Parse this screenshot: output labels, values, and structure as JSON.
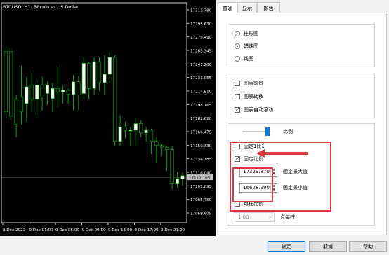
{
  "chart": {
    "title": "BTCUSD, H1: Bitcoin vs US Dollar",
    "price_labels": [
      "17311.780",
      "17295.630",
      "17279.490",
      "17263.345",
      "17247.200",
      "17231.055",
      "17214.910",
      "17198.765",
      "17182.620",
      "17166.475",
      "17150.330",
      "17134.185",
      "17118.040",
      "17101.895",
      "17085.750",
      "17069.605"
    ],
    "current_price": "17112.105",
    "time_labels": [
      "8 Dec 2022",
      "9 Dec 01:00",
      "9 Dec 05:00",
      "9 Dec 09:00",
      "9 Dec 13:00",
      "9 Dec 17:00",
      "9 Dec 21:00"
    ],
    "bull_color": "#ffffff",
    "bear_color": "#000000",
    "wick_color": "#00c000",
    "bg_color": "#000000"
  },
  "tabs": [
    {
      "label": "普通"
    },
    {
      "label": "显示"
    },
    {
      "label": "颜色"
    }
  ],
  "chart_type": {
    "options": [
      {
        "label": "柱形图",
        "selected": false
      },
      {
        "label": "蜡烛图",
        "selected": true
      },
      {
        "label": "线图",
        "selected": false
      }
    ]
  },
  "chart_options": {
    "items": [
      {
        "label": "图表前景",
        "checked": false
      },
      {
        "label": "图表转移",
        "checked": false
      },
      {
        "label": "图表自动滚动",
        "checked": true
      }
    ]
  },
  "scale": {
    "slider_label": "比例",
    "fix_1to1": {
      "label": "固定1比1",
      "checked": false
    },
    "fixed_scale": {
      "label": "固定比例",
      "checked": true
    },
    "max_value": "17329.870",
    "max_label": "固定最大值",
    "min_value": "16628.990",
    "min_label": "固定最小值",
    "per_bar": {
      "label": "每柱比例",
      "checked": false
    },
    "per_bar_value": "1.00",
    "per_bar_unit": "点每柱"
  },
  "highlight_color": "#d9363e",
  "buttons": {
    "ok": "确定",
    "cancel": "取消",
    "help": "帮助"
  }
}
